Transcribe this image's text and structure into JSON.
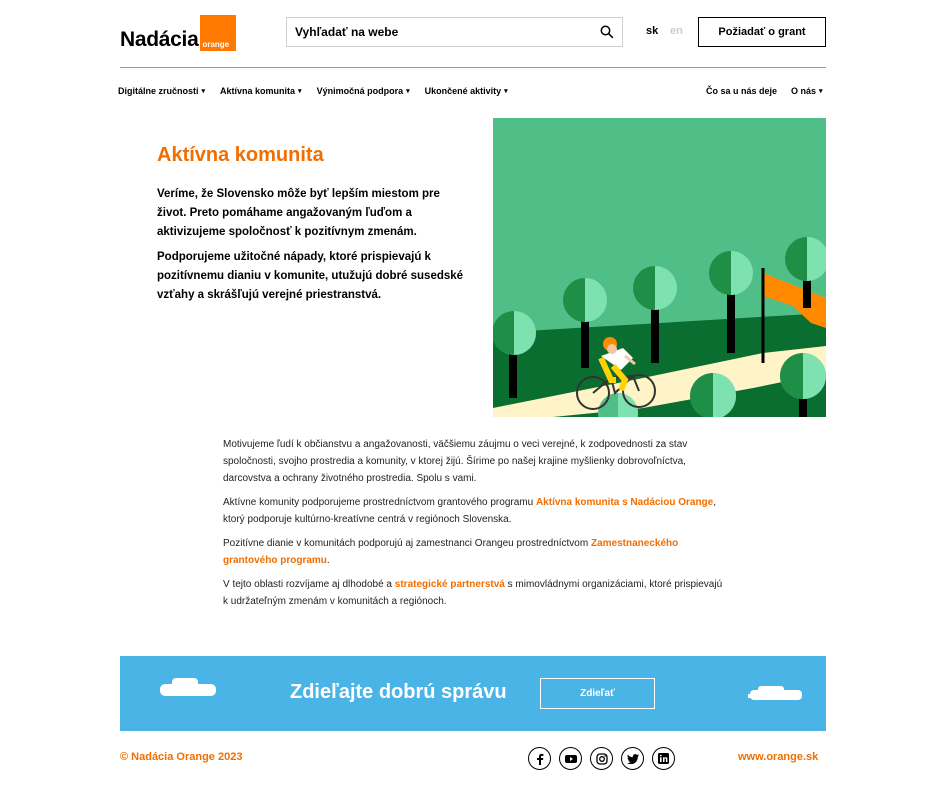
{
  "header": {
    "logo_text": "Nadácia",
    "logo_box_text": "orange",
    "search_placeholder": "Vyhľadať na webe",
    "lang_sk": "sk",
    "lang_en": "en",
    "grant_button": "Požiadať o grant"
  },
  "nav": {
    "left": [
      {
        "label": "Digitálne zručnosti"
      },
      {
        "label": "Aktívna komunita"
      },
      {
        "label": "Výnimočná podpora"
      },
      {
        "label": "Ukončené aktivity"
      }
    ],
    "right": [
      {
        "label": "Čo sa u nás deje",
        "dropdown": false
      },
      {
        "label": "O nás",
        "dropdown": true
      }
    ],
    "caret": "▾"
  },
  "hero": {
    "title": "Aktívna komunita",
    "p1": "Veríme, že Slovensko môže byť lepším miestom pre život. Preto pomáhame angažovaným ľuďom a aktivizujeme spoločnosť k pozitívnym zmenám.",
    "p2": "Podporujeme užitočné nápady, ktoré prispievajú k pozitívnemu dianiu v komunite, utužujú dobré susedské vzťahy a skrášľujú verejné priestranstvá."
  },
  "body": {
    "p1": "Motivujeme ľudí k občianstvu a angažovanosti, väčšiemu záujmu o veci verejné, k zodpovednosti za stav spoločnosti, svojho prostredia a komunity, v ktorej žijú. Šírime po našej krajine myšlienky dobrovoľníctva, darcovstva a ochrany životného prostredia. Spolu s vami.",
    "p2_before": "Aktívne komunity podporujeme prostredníctvom grantového programu ",
    "p2_link": "Aktívna komunita s Nadáciou Orange",
    "p2_after": ", ktorý podporuje kultúrno-kreatívne centrá v regiónoch Slovenska.",
    "p3_before": "Pozitívne dianie v komunitách podporujú aj zamestnanci Orangeu prostredníctvom ",
    "p3_link": "Zamestnaneckého grantového programu",
    "p3_after": ".",
    "p4_before": "V tejto oblasti rozvíjame aj dlhodobé a ",
    "p4_link": "strategické partnerstvá",
    "p4_after": " s mimovládnymi organizáciami, ktoré prispievajú k udržateľným zmenám v komunitách a regiónoch."
  },
  "banner": {
    "title": "Zdieľajte dobrú správu",
    "button": "Zdieľať"
  },
  "footer": {
    "copyright": "© Nadácia Orange 2023",
    "website": "www.orange.sk",
    "socials": [
      {
        "icon": "facebook-icon",
        "glyph": "f"
      },
      {
        "icon": "youtube-icon",
        "glyph": "▶"
      },
      {
        "icon": "instagram-icon",
        "glyph": "◎"
      },
      {
        "icon": "twitter-icon",
        "glyph": "🐦"
      },
      {
        "icon": "linkedin-icon",
        "glyph": "in"
      }
    ]
  },
  "colors": {
    "accent": "#f16e00",
    "brand_orange": "#ff7900",
    "banner_blue": "#4bb4e6",
    "hero_green": "#50be87"
  }
}
